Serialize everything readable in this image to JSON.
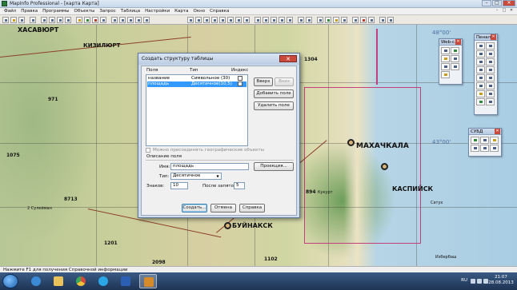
{
  "window": {
    "title": "MapInfo Professional - [карта Карта]",
    "controls": [
      "–",
      "□",
      "✕"
    ]
  },
  "menu": [
    "Файл",
    "Правка",
    "Программы",
    "Объекты",
    "Запрос",
    "Таблица",
    "Настройки",
    "Карта",
    "Окно",
    "Справка"
  ],
  "mdi_controls": [
    "–",
    "□",
    "✕"
  ],
  "map": {
    "labels": [
      {
        "text": "ХАСАВЮРТ",
        "size": 8
      },
      {
        "text": "КИЗИЛЮРТ",
        "size": 7
      },
      {
        "text": "МАХАЧКАЛА",
        "size": 9
      },
      {
        "text": "КАСПИЙСК",
        "size": 8
      },
      {
        "text": "БУЙНАКСК",
        "size": 8
      },
      {
        "text": "971",
        "size": 6
      },
      {
        "text": "894",
        "size": 6
      },
      {
        "text": "2098",
        "size": 6
      },
      {
        "text": "1075",
        "size": 6
      },
      {
        "text": "1201",
        "size": 6
      },
      {
        "text": "8713",
        "size": 6
      },
      {
        "text": "1102",
        "size": 6
      },
      {
        "text": "1304",
        "size": 6
      },
      {
        "text": "2 Сулейман",
        "size": 5
      },
      {
        "text": "Кукурт",
        "size": 5
      },
      {
        "text": "Сатух",
        "size": 5
      },
      {
        "text": "Избербаш",
        "size": 5
      }
    ],
    "sea_labels": [
      "43°00'",
      "48°00'"
    ]
  },
  "palettes": {
    "web": {
      "title": "Web-с..."
    },
    "penal": {
      "title": "Пенал"
    },
    "subd": {
      "title": "СУБД"
    }
  },
  "dialog": {
    "title": "Создать структуру таблицы",
    "close": "✕",
    "headers": {
      "field": "Поля",
      "type": "Тип",
      "index": "Индекс"
    },
    "rows": [
      {
        "field": "название",
        "type": "Символьное (30)"
      },
      {
        "field": "площадь",
        "type": "Десятичное(10,5)"
      }
    ],
    "buttons": {
      "up": "Вверх",
      "down": "Вниз",
      "add": "Добавить поле",
      "remove": "Удалить поле",
      "projection": "Проекция...",
      "create": "Создать...",
      "cancel": "Отмена",
      "help": "Справка"
    },
    "geo_checkbox": "Можно присоединять географические объекты",
    "field_desc": "Описание поля",
    "name_label": "Имя:",
    "name_value": "площадь",
    "type_label": "Тип:",
    "type_value": "Десятичное",
    "digits_label": "Знаков:",
    "digits_value": "10",
    "after_comma_label": "После запятой:",
    "after_comma_value": "5"
  },
  "statusbar": {
    "text": "Нажмите F1 для получения Справочной информации"
  },
  "taskbar": {
    "lang": "RU",
    "time": "21:07",
    "date": "28.08.2013",
    "apps": [
      {
        "icon": "ie-icon",
        "color": "#3a8ad6"
      },
      {
        "icon": "explorer-icon",
        "color": "#e9c35a"
      },
      {
        "icon": "chrome-icon",
        "color": "#d64a3a"
      },
      {
        "icon": "skype-icon",
        "color": "#2aa7e6"
      },
      {
        "icon": "word-icon",
        "color": "#2b5fb4"
      },
      {
        "icon": "mapinfo-icon",
        "color": "#d58a2c"
      }
    ]
  }
}
